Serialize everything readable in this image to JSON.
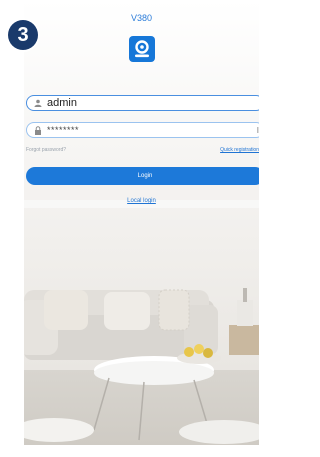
{
  "step_badge": "3",
  "app": {
    "title": "V380"
  },
  "login": {
    "username_value": "admin",
    "password_value": "********",
    "forgot_label": "Forgot password?",
    "quick_register_label": "Quick registration",
    "login_label": "Login",
    "local_login_label": "Local login"
  },
  "icons": {
    "logo": "v380-logo-icon",
    "user": "user-icon",
    "lock": "lock-icon",
    "eye": "eye-toggle-icon"
  },
  "colors": {
    "accent": "#1d79d9",
    "badge": "#1a3a6b"
  }
}
